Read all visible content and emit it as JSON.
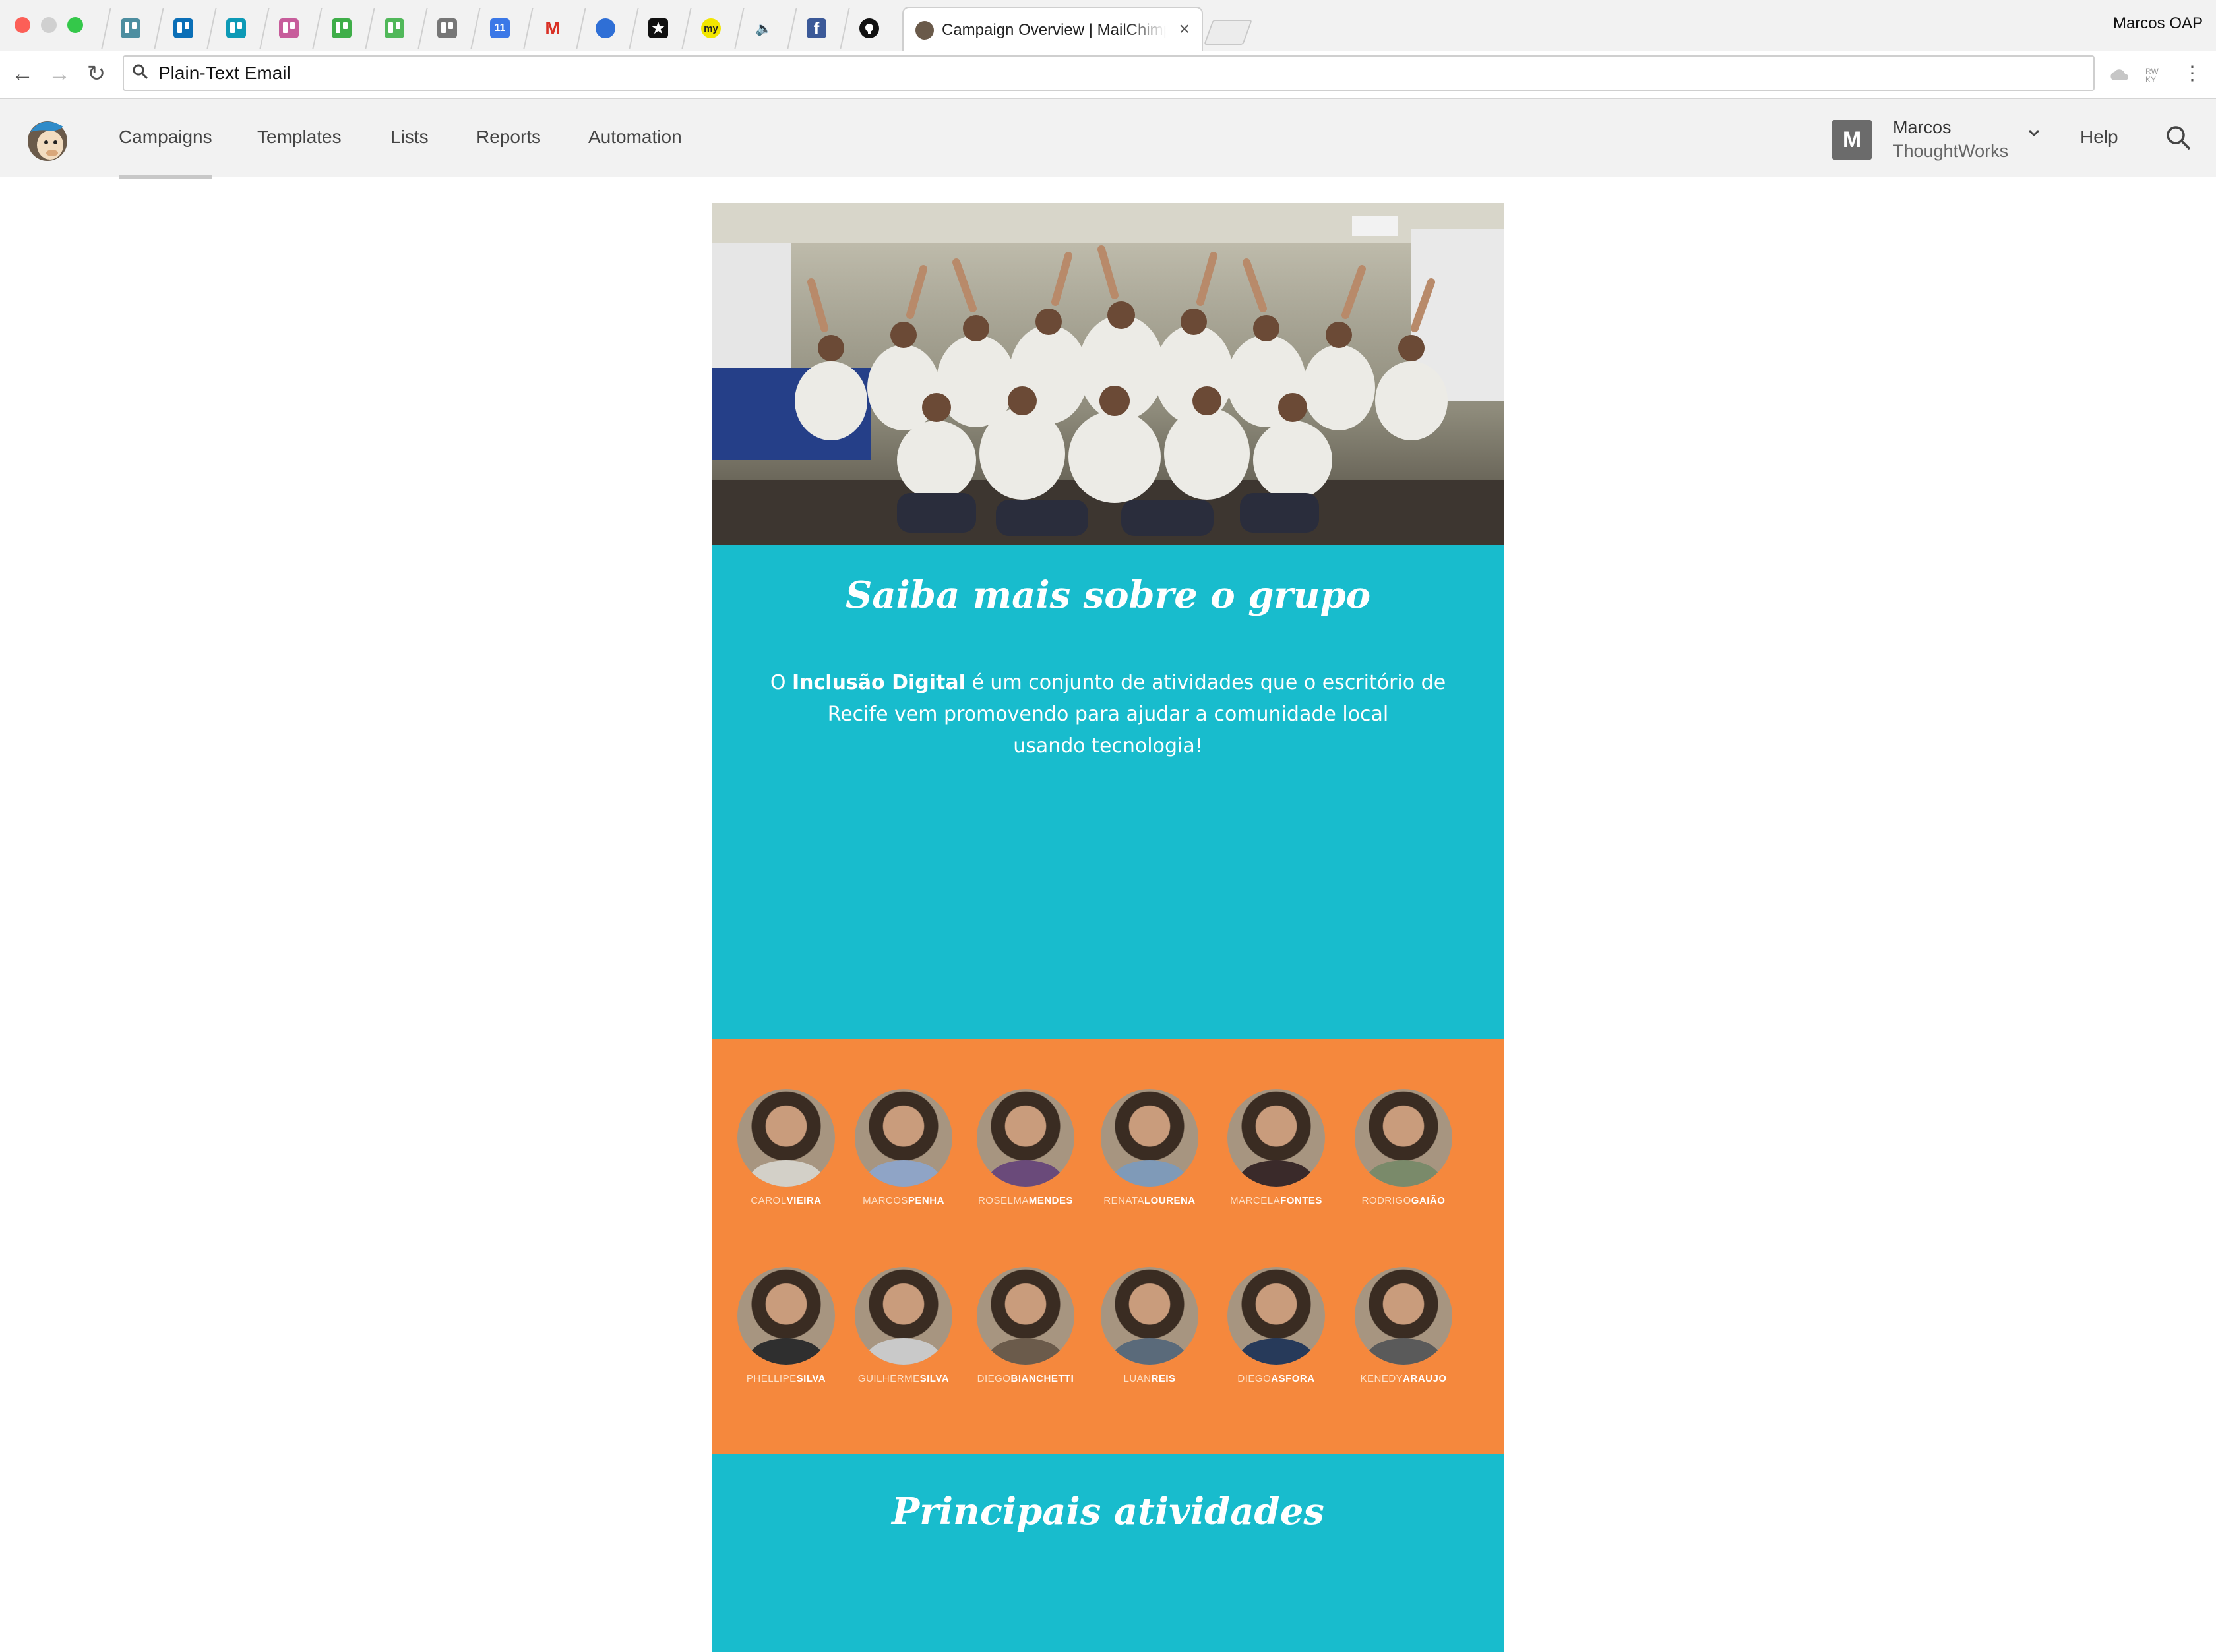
{
  "browser": {
    "profile": "Marcos OAP",
    "active_tab_title": "Campaign Overview | MailChimp",
    "address": "Plain-Text Email",
    "close_glyph": "×",
    "back_glyph": "←",
    "forward_glyph": "→",
    "reload_glyph": "↻",
    "menu_glyph": "⋮",
    "pinned_tabs": [
      {
        "icon": "trello-gray-icon"
      },
      {
        "icon": "trello-blue-icon"
      },
      {
        "icon": "trello-teal-icon"
      },
      {
        "icon": "trello-pink-icon"
      },
      {
        "icon": "trello-green-icon"
      },
      {
        "icon": "trello-lightgreen-icon"
      },
      {
        "icon": "trello-darkgray-icon"
      },
      {
        "icon": "calendar-icon",
        "text": "11"
      },
      {
        "icon": "gmail-icon",
        "text": "M"
      },
      {
        "icon": "inbox-icon"
      },
      {
        "icon": "star-app-icon"
      },
      {
        "icon": "my-app-icon",
        "text": "my"
      },
      {
        "icon": "speaker-icon"
      },
      {
        "icon": "facebook-icon",
        "text": "f"
      },
      {
        "icon": "github-icon"
      }
    ]
  },
  "app_nav": {
    "items": [
      {
        "label": "Campaigns",
        "active": true
      },
      {
        "label": "Templates"
      },
      {
        "label": "Lists"
      },
      {
        "label": "Reports"
      },
      {
        "label": "Automation"
      }
    ],
    "avatar_initial": "M",
    "account_name": "Marcos",
    "account_org": "ThoughtWorks",
    "help": "Help"
  },
  "email": {
    "section1_title": "Saiba mais sobre o grupo",
    "intro_prefix": "O ",
    "intro_bold": "Inclusão Digital",
    "intro_line1_rest": " é um conjunto de atividades que o escritório de",
    "intro_line2": "Recife vem promovendo para ajudar a comunidade local",
    "intro_line3": "usando tecnologia!",
    "people": [
      {
        "first": "CAROL",
        "last": "VIEIRA"
      },
      {
        "first": "MARCOS",
        "last": "PENHA"
      },
      {
        "first": "ROSELMA",
        "last": "MENDES"
      },
      {
        "first": "RENATA",
        "last": "LOURENA"
      },
      {
        "first": "MARCELA",
        "last": "FONTES"
      },
      {
        "first": "RODRIGO",
        "last": "GAIÃO"
      },
      {
        "first": "PHELLIPE",
        "last": "SILVA"
      },
      {
        "first": "GUILHERME",
        "last": "SILVA"
      },
      {
        "first": "DIEGO",
        "last": "BIANCHETTI"
      },
      {
        "first": "LUAN",
        "last": "REIS"
      },
      {
        "first": "DIEGO",
        "last": "ASFORA"
      },
      {
        "first": "KENEDY",
        "last": "ARAUJO"
      }
    ],
    "section2_title": "Principais atividades"
  },
  "colors": {
    "teal": "#18bccd",
    "orange": "#f5883d",
    "nav_bg": "#f2f2f2"
  }
}
